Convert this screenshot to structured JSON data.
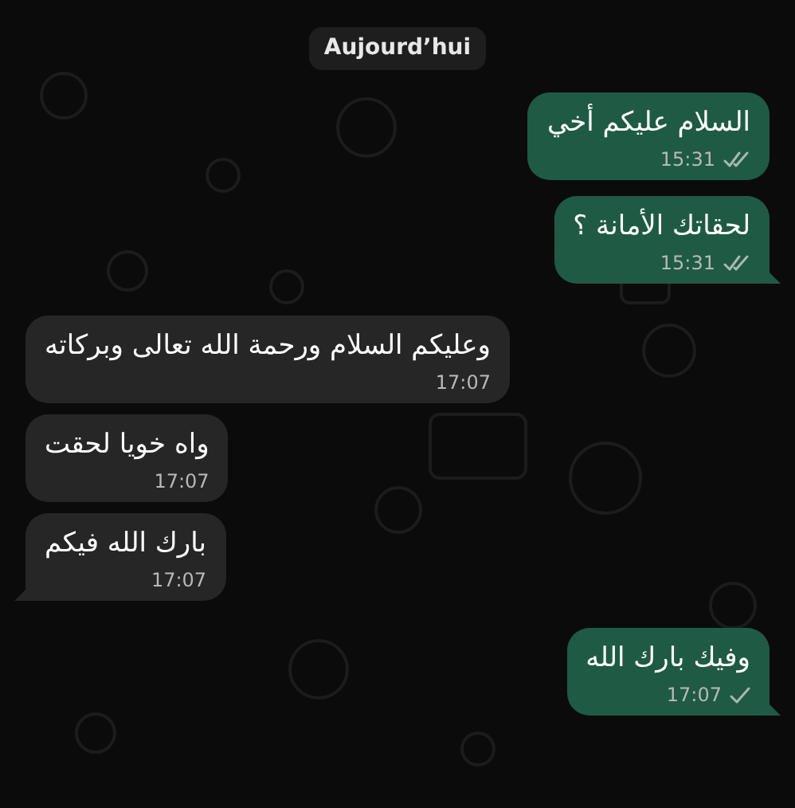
{
  "date_chip": "Aujourd’hui",
  "messages": [
    {
      "kind": "outgoing",
      "text": "السلام عليكم أخي",
      "time": "15:31",
      "delivered": true,
      "tail": false
    },
    {
      "kind": "outgoing",
      "text": "لحقاتك الأمانة ؟",
      "time": "15:31",
      "delivered": true,
      "tail": true
    },
    {
      "kind": "incoming",
      "text": "وعليكم السلام ورحمة الله تعالى وبركاته",
      "time": "17:07",
      "tail": false
    },
    {
      "kind": "incoming",
      "text": "واه خويا لحقت",
      "time": "17:07",
      "tail": false
    },
    {
      "kind": "incoming",
      "text": "بارك الله فيكم",
      "time": "17:07",
      "tail": true
    },
    {
      "kind": "outgoing",
      "text": "وفيك بارك الله",
      "time": "17:07",
      "delivered": false,
      "tail": true
    }
  ]
}
